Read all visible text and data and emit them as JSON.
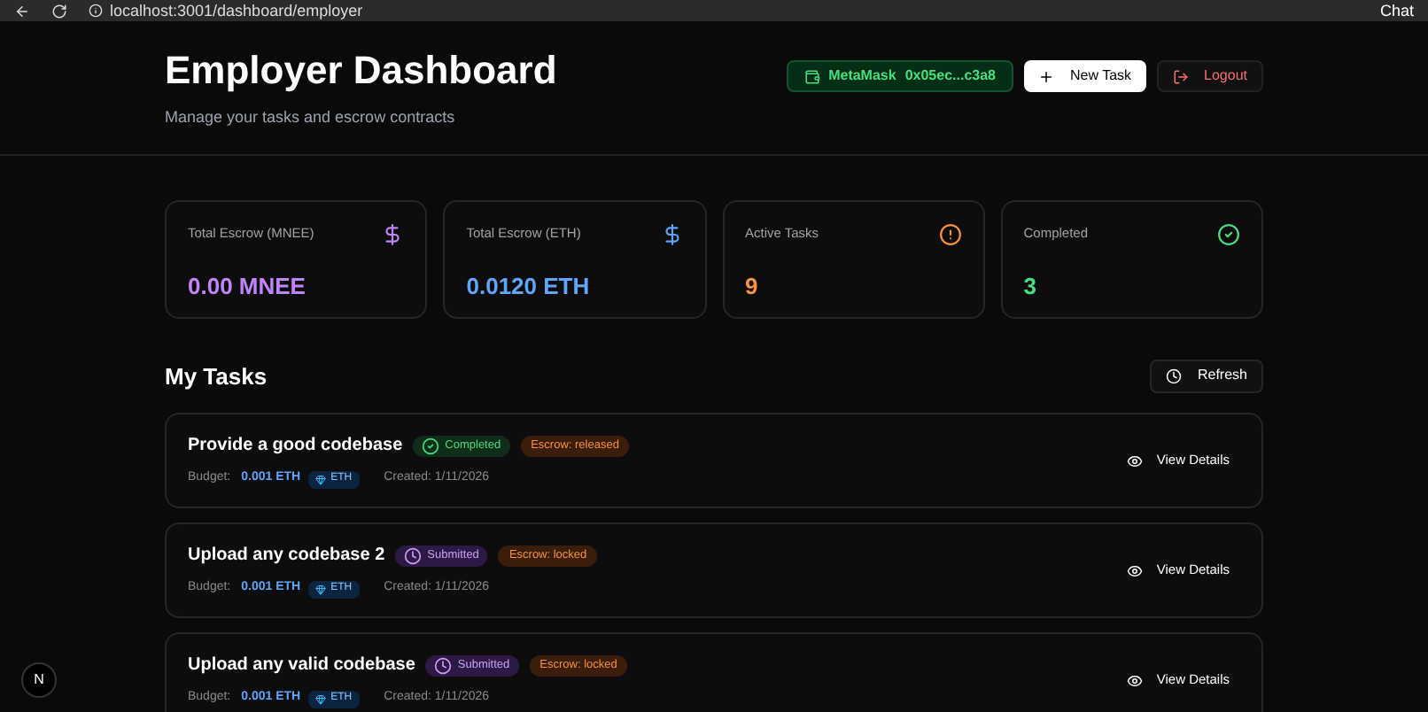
{
  "browser": {
    "url": "localhost:3001/dashboard/employer",
    "chat": "Chat"
  },
  "header": {
    "title": "Employer Dashboard",
    "subtitle": "Manage your tasks and escrow contracts",
    "wallet": {
      "name": "MetaMask",
      "address": "0x05ec...c3a8"
    },
    "new_task": "New Task",
    "logout": "Logout"
  },
  "stats": [
    {
      "label": "Total Escrow (MNEE)",
      "value": "0.00 MNEE",
      "kind": "mnee",
      "color": "#c084fc"
    },
    {
      "label": "Total Escrow (ETH)",
      "value": "0.0120 ETH",
      "kind": "eth",
      "color": "#60a5fa"
    },
    {
      "label": "Active Tasks",
      "value": "9",
      "kind": "active",
      "color": "#fb923c"
    },
    {
      "label": "Completed",
      "value": "3",
      "kind": "completed",
      "color": "#4ade80"
    }
  ],
  "tasks_section": {
    "title": "My Tasks",
    "refresh": "Refresh"
  },
  "tasks": [
    {
      "title": "Provide a good codebase",
      "status": {
        "label": "Completed",
        "kind": "completed"
      },
      "escrow": "Escrow: released",
      "budget_label": "Budget:",
      "budget": "0.001 ETH",
      "currency": "ETH",
      "created": "Created: 1/11/2026",
      "action": "View Details"
    },
    {
      "title": "Upload any codebase 2",
      "status": {
        "label": "Submitted",
        "kind": "submitted"
      },
      "escrow": "Escrow: locked",
      "budget_label": "Budget:",
      "budget": "0.001 ETH",
      "currency": "ETH",
      "created": "Created: 1/11/2026",
      "action": "View Details"
    },
    {
      "title": "Upload any valid codebase",
      "status": {
        "label": "Submitted",
        "kind": "submitted"
      },
      "escrow": "Escrow: locked",
      "budget_label": "Budget:",
      "budget": "0.001 ETH",
      "currency": "ETH",
      "created": "Created: 1/11/2026",
      "action": "View Details"
    }
  ],
  "dev_badge": "N"
}
